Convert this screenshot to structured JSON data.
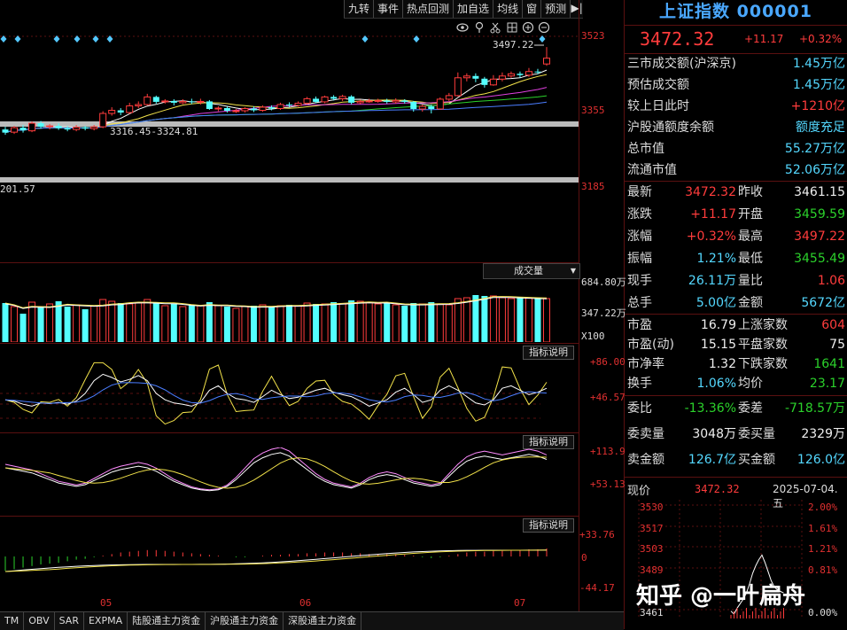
{
  "toolbar": {
    "buttons": [
      "九转",
      "事件",
      "热点回测",
      "加自选",
      "均线",
      "窗",
      "预测"
    ],
    "end_glyph": "▶|"
  },
  "chart_icons": [
    "eye-icon",
    "pin-icon",
    "scissors-icon",
    "grid-icon",
    "zoom-in-icon",
    "zoom-out-icon"
  ],
  "main_chart": {
    "y_ticks": [
      "3523",
      "3355",
      "3185"
    ],
    "high_annotation": "3497.22",
    "range_annotation": "3316.45-3324.81",
    "left_annotation": "201.57",
    "candles": [
      {
        "o": 3312,
        "c": 3305,
        "h": 3318,
        "l": 3300
      },
      {
        "o": 3306,
        "c": 3316,
        "h": 3320,
        "l": 3302
      },
      {
        "o": 3316,
        "c": 3310,
        "h": 3322,
        "l": 3305
      },
      {
        "o": 3309,
        "c": 3326,
        "h": 3330,
        "l": 3306
      },
      {
        "o": 3326,
        "c": 3318,
        "h": 3331,
        "l": 3314
      },
      {
        "o": 3318,
        "c": 3320,
        "h": 3324,
        "l": 3312
      },
      {
        "o": 3320,
        "c": 3315,
        "h": 3326,
        "l": 3311
      },
      {
        "o": 3315,
        "c": 3312,
        "h": 3320,
        "l": 3308
      },
      {
        "o": 3312,
        "c": 3317,
        "h": 3322,
        "l": 3308
      },
      {
        "o": 3317,
        "c": 3314,
        "h": 3320,
        "l": 3310
      },
      {
        "o": 3314,
        "c": 3318,
        "h": 3322,
        "l": 3310
      },
      {
        "o": 3318,
        "c": 3348,
        "h": 3353,
        "l": 3315
      },
      {
        "o": 3348,
        "c": 3355,
        "h": 3362,
        "l": 3343
      },
      {
        "o": 3355,
        "c": 3350,
        "h": 3360,
        "l": 3344
      },
      {
        "o": 3350,
        "c": 3365,
        "h": 3372,
        "l": 3347
      },
      {
        "o": 3365,
        "c": 3368,
        "h": 3375,
        "l": 3360
      },
      {
        "o": 3368,
        "c": 3385,
        "h": 3392,
        "l": 3366
      },
      {
        "o": 3385,
        "c": 3374,
        "h": 3388,
        "l": 3370
      },
      {
        "o": 3374,
        "c": 3376,
        "h": 3380,
        "l": 3370
      },
      {
        "o": 3376,
        "c": 3372,
        "h": 3380,
        "l": 3366
      },
      {
        "o": 3372,
        "c": 3375,
        "h": 3380,
        "l": 3369
      },
      {
        "o": 3375,
        "c": 3373,
        "h": 3381,
        "l": 3369
      },
      {
        "o": 3373,
        "c": 3375,
        "h": 3381,
        "l": 3368
      },
      {
        "o": 3375,
        "c": 3358,
        "h": 3378,
        "l": 3356
      },
      {
        "o": 3358,
        "c": 3360,
        "h": 3364,
        "l": 3353
      },
      {
        "o": 3360,
        "c": 3354,
        "h": 3364,
        "l": 3350
      },
      {
        "o": 3354,
        "c": 3354,
        "h": 3358,
        "l": 3349
      },
      {
        "o": 3354,
        "c": 3359,
        "h": 3362,
        "l": 3350
      },
      {
        "o": 3359,
        "c": 3355,
        "h": 3364,
        "l": 3351
      },
      {
        "o": 3355,
        "c": 3362,
        "h": 3366,
        "l": 3352
      },
      {
        "o": 3362,
        "c": 3359,
        "h": 3366,
        "l": 3355
      },
      {
        "o": 3359,
        "c": 3368,
        "h": 3372,
        "l": 3356
      },
      {
        "o": 3368,
        "c": 3366,
        "h": 3373,
        "l": 3362
      },
      {
        "o": 3366,
        "c": 3371,
        "h": 3375,
        "l": 3363
      },
      {
        "o": 3371,
        "c": 3381,
        "h": 3385,
        "l": 3368
      },
      {
        "o": 3381,
        "c": 3374,
        "h": 3386,
        "l": 3371
      },
      {
        "o": 3374,
        "c": 3385,
        "h": 3388,
        "l": 3371
      },
      {
        "o": 3385,
        "c": 3381,
        "h": 3389,
        "l": 3377
      },
      {
        "o": 3381,
        "c": 3386,
        "h": 3390,
        "l": 3376
      },
      {
        "o": 3386,
        "c": 3372,
        "h": 3389,
        "l": 3368
      },
      {
        "o": 3372,
        "c": 3375,
        "h": 3379,
        "l": 3369
      },
      {
        "o": 3375,
        "c": 3376,
        "h": 3381,
        "l": 3372
      },
      {
        "o": 3376,
        "c": 3377,
        "h": 3381,
        "l": 3372
      },
      {
        "o": 3377,
        "c": 3374,
        "h": 3381,
        "l": 3370
      },
      {
        "o": 3374,
        "c": 3377,
        "h": 3382,
        "l": 3370
      },
      {
        "o": 3377,
        "c": 3374,
        "h": 3380,
        "l": 3370
      },
      {
        "o": 3374,
        "c": 3358,
        "h": 3376,
        "l": 3352
      },
      {
        "o": 3358,
        "c": 3364,
        "h": 3368,
        "l": 3352
      },
      {
        "o": 3364,
        "c": 3358,
        "h": 3368,
        "l": 3348
      },
      {
        "o": 3358,
        "c": 3380,
        "h": 3384,
        "l": 3356
      },
      {
        "o": 3380,
        "c": 3388,
        "h": 3394,
        "l": 3376
      },
      {
        "o": 3388,
        "c": 3428,
        "h": 3440,
        "l": 3386
      },
      {
        "o": 3428,
        "c": 3432,
        "h": 3438,
        "l": 3420
      },
      {
        "o": 3432,
        "c": 3426,
        "h": 3438,
        "l": 3418
      },
      {
        "o": 3426,
        "c": 3412,
        "h": 3430,
        "l": 3406
      },
      {
        "o": 3412,
        "c": 3425,
        "h": 3434,
        "l": 3410
      },
      {
        "o": 3425,
        "c": 3432,
        "h": 3440,
        "l": 3420
      },
      {
        "o": 3432,
        "c": 3437,
        "h": 3442,
        "l": 3428
      },
      {
        "o": 3437,
        "c": 3434,
        "h": 3442,
        "l": 3428
      },
      {
        "o": 3434,
        "c": 3442,
        "h": 3450,
        "l": 3430
      },
      {
        "o": 3442,
        "c": 3441,
        "h": 3448,
        "l": 3436
      },
      {
        "o": 3459,
        "c": 3472,
        "h": 3497,
        "l": 3455
      }
    ]
  },
  "volume_panel": {
    "dropdown_label": "成交量",
    "ticks": [
      "684.80万",
      "347.22万",
      "X100"
    ]
  },
  "indicator1": {
    "button": "指标说明",
    "ticks": [
      "+86.00",
      "+46.57"
    ]
  },
  "indicator2": {
    "button": "指标说明",
    "ticks": [
      "+113.9",
      "+53.13"
    ]
  },
  "indicator3": {
    "button": "指标说明",
    "ticks": [
      "+33.76",
      "0",
      "-44.17"
    ]
  },
  "x_axis_labels": [
    "05",
    "06",
    "07"
  ],
  "bottom_tabs": [
    "TM",
    "OBV",
    "SAR",
    "EXPMA",
    "陆股通主力资金",
    "沪股通主力资金",
    "深股通主力资金"
  ],
  "quote": {
    "title": "上证指数 000001",
    "price": "3472.32",
    "change": "+11.17",
    "change_pct": "+0.32%",
    "info_rows": [
      {
        "label": "三市成交额(沪深京)",
        "value": "1.45万亿",
        "color": "cyan"
      },
      {
        "label": "预估成交额",
        "value": "1.45万亿",
        "color": "cyan"
      },
      {
        "label": "较上日此时",
        "value": "+1210亿",
        "color": "red"
      },
      {
        "label": "沪股通额度余额",
        "value": "额度充足",
        "color": "cyan"
      },
      {
        "label": "总市值",
        "value": "55.27万亿",
        "color": "cyan"
      },
      {
        "label": "流通市值",
        "value": "52.06万亿",
        "color": "cyan"
      }
    ],
    "pairs_a": [
      {
        "l1": "最新",
        "v1": "3472.32",
        "c1": "red",
        "l2": "昨收",
        "v2": "3461.15",
        "c2": "white"
      },
      {
        "l1": "涨跌",
        "v1": "+11.17",
        "c1": "red",
        "l2": "开盘",
        "v2": "3459.59",
        "c2": "green"
      },
      {
        "l1": "涨幅",
        "v1": "+0.32%",
        "c1": "red",
        "l2": "最高",
        "v2": "3497.22",
        "c2": "red"
      },
      {
        "l1": "振幅",
        "v1": "1.21%",
        "c1": "cyan",
        "l2": "最低",
        "v2": "3455.49",
        "c2": "green"
      },
      {
        "l1": "现手",
        "v1": "26.11万",
        "c1": "cyan",
        "l2": "量比",
        "v2": "1.06",
        "c2": "red"
      },
      {
        "l1": "总手",
        "v1": "5.00亿",
        "c1": "cyan",
        "l2": "金额",
        "v2": "5672亿",
        "c2": "cyan"
      }
    ],
    "pairs_b": [
      {
        "l1": "市盈",
        "v1": "16.79",
        "c1": "white",
        "l2": "上涨家数",
        "v2": "604",
        "c2": "red"
      },
      {
        "l1": "市盈(动)",
        "v1": "15.15",
        "c1": "white",
        "l2": "平盘家数",
        "v2": "75",
        "c2": "white"
      },
      {
        "l1": "市净率",
        "v1": "1.32",
        "c1": "white",
        "l2": "下跌家数",
        "v2": "1641",
        "c2": "green"
      },
      {
        "l1": "换手",
        "v1": "1.06%",
        "c1": "cyan",
        "l2": "均价",
        "v2": "23.17",
        "c2": "green"
      }
    ],
    "pairs_c": [
      {
        "l1": "委比",
        "v1": "-13.36%",
        "c1": "green",
        "l2": "委差",
        "v2": "-718.57万",
        "c2": "green"
      },
      {
        "l1": "委卖量",
        "v1": "3048万",
        "c1": "white",
        "l2": "委买量",
        "v2": "2329万",
        "c2": "white"
      },
      {
        "l1": "卖金额",
        "v1": "126.7亿",
        "c1": "cyan",
        "l2": "买金额",
        "v2": "126.0亿",
        "c2": "cyan"
      }
    ],
    "mini": {
      "price_label": "现价",
      "price": "3472.32",
      "date": "2025-07-04.五",
      "left_ticks": [
        "3530",
        "3517",
        "3503",
        "3489",
        "3461"
      ],
      "right_ticks": [
        "2.00%",
        "1.61%",
        "1.21%",
        "0.81%",
        "0.00%"
      ]
    }
  },
  "watermark": "知乎 @一叶扁舟"
}
